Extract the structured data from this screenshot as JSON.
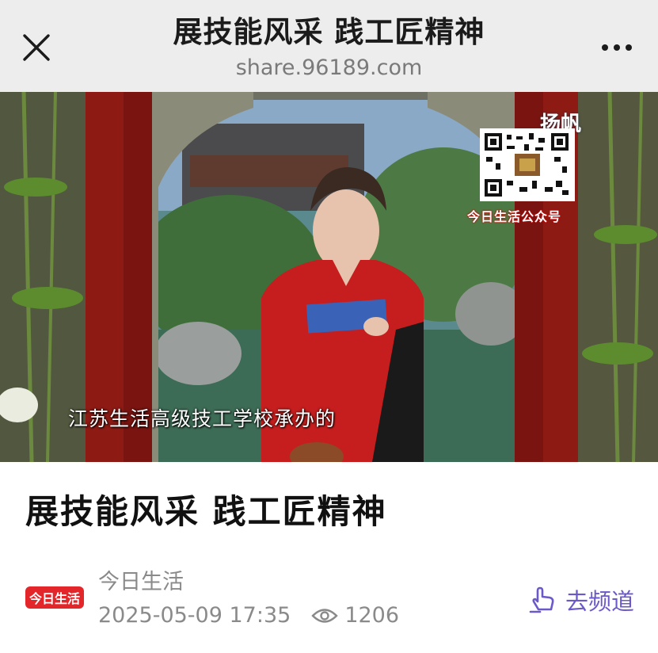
{
  "header": {
    "title": "展技能风采 践工匠精神",
    "domain": "share.96189.com",
    "close_icon": "close-icon",
    "more_icon": "more-dots-icon"
  },
  "video": {
    "subtitle": "江苏生活高级技工学校承办的",
    "qr_caption": "今日生活公众号",
    "watermark": "扬帆"
  },
  "article": {
    "title": "展技能风采 践工匠精神",
    "source_name": "今日生活",
    "logo_text": "今日生活",
    "date": "2025-05-09 17:35",
    "views": "1206",
    "views_icon": "eye-icon"
  },
  "channel_button": {
    "label": "去频道",
    "icon": "hand-pointer-icon",
    "color": "#6b58c9"
  }
}
